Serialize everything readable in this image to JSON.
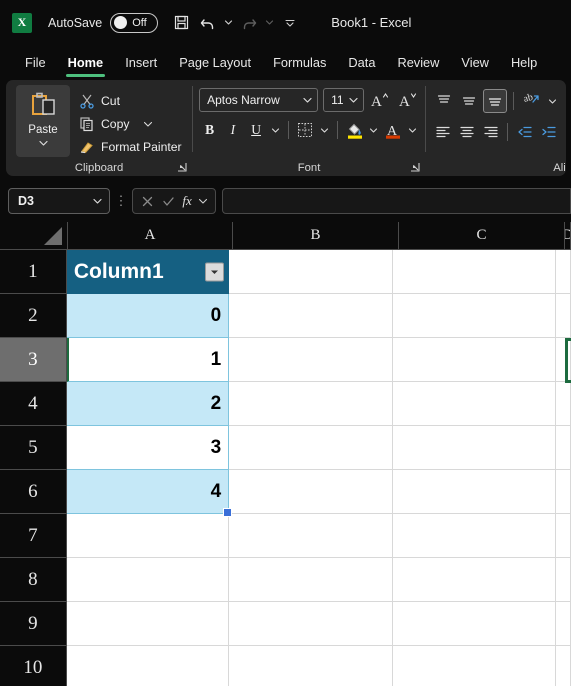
{
  "titlebar": {
    "app_icon": "excel-logo-icon",
    "autosave_label": "AutoSave",
    "autosave_state": "Off",
    "save_icon": "save-icon",
    "undo_icon": "undo-icon",
    "redo_icon": "redo-icon",
    "customize_qat_icon": "customize-quick-access-toolbar-icon",
    "document_title": "Book1  -  Excel"
  },
  "ribbon_tabs": {
    "items": [
      {
        "label": "File",
        "active": false
      },
      {
        "label": "Home",
        "active": true
      },
      {
        "label": "Insert",
        "active": false
      },
      {
        "label": "Page Layout",
        "active": false
      },
      {
        "label": "Formulas",
        "active": false
      },
      {
        "label": "Data",
        "active": false
      },
      {
        "label": "Review",
        "active": false
      },
      {
        "label": "View",
        "active": false
      },
      {
        "label": "Help",
        "active": false
      }
    ]
  },
  "ribbon": {
    "clipboard": {
      "group_label": "Clipboard",
      "paste_label": "Paste",
      "cut_label": "Cut",
      "copy_label": "Copy",
      "format_painter_label": "Format Painter"
    },
    "font": {
      "group_label": "Font",
      "font_name": "Aptos Narrow",
      "font_size": "11",
      "bold_label": "B",
      "italic_label": "I",
      "underline_label": "U",
      "font_color_label": "A",
      "highlight_color": "#ffe600",
      "font_color": "#d83b01"
    },
    "alignment": {
      "group_label": "Alignme"
    }
  },
  "formula_bar": {
    "name_box_value": "D3",
    "cancel_icon": "cancel-icon",
    "enter_icon": "enter-checkmark-icon",
    "fx_label": "fx",
    "formula_value": "",
    "formula_placeholder": ""
  },
  "grid": {
    "columns": [
      "A",
      "B",
      "C",
      "D"
    ],
    "rows": [
      "1",
      "2",
      "3",
      "4",
      "5",
      "6",
      "7",
      "8",
      "9",
      "10"
    ],
    "active_cell": "D3",
    "active_row": "3",
    "table": {
      "header_text": "Column1",
      "header_bg": "#156082",
      "band_bg": "#c5e8f7",
      "filter_icon": "filter-dropdown-icon",
      "values": [
        "0",
        "1",
        "2",
        "3",
        "4"
      ]
    },
    "cells": [
      {
        "row": "1",
        "a": "Column1",
        "kind": "header",
        "banded": false
      },
      {
        "row": "2",
        "a": "0",
        "kind": "data",
        "banded": true
      },
      {
        "row": "3",
        "a": "1",
        "kind": "data",
        "banded": false
      },
      {
        "row": "4",
        "a": "2",
        "kind": "data",
        "banded": true
      },
      {
        "row": "5",
        "a": "3",
        "kind": "data",
        "banded": false
      },
      {
        "row": "6",
        "a": "4",
        "kind": "data",
        "banded": true
      },
      {
        "row": "7",
        "a": "",
        "kind": "empty",
        "banded": false
      },
      {
        "row": "8",
        "a": "",
        "kind": "empty",
        "banded": false
      },
      {
        "row": "9",
        "a": "",
        "kind": "empty",
        "banded": false
      },
      {
        "row": "10",
        "a": "",
        "kind": "empty",
        "banded": false
      }
    ]
  }
}
